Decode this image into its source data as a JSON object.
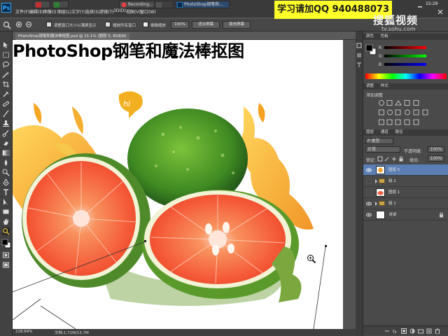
{
  "menubar": {
    "logo": "Ps",
    "items": [
      "文件(F)",
      "编辑(E)",
      "图像(I)",
      "图层(L)",
      "文字(Y)",
      "选择(S)",
      "滤镜(T)",
      "3D(D)",
      "视图(V)",
      "窗口(W)"
    ],
    "taskbar_tabs": [
      {
        "label": ""
      },
      {
        "label": ""
      },
      {
        "label": "Recording..."
      },
      {
        "label": ""
      },
      {
        "label": "PhotoShop钢笔和..."
      }
    ],
    "qq_banner": "学习请加QQ 940488073",
    "clock": "15:29"
  },
  "options": {
    "resize_windows": "调整窗口大小以满屏显示",
    "zoom_all": "缩放所有窗口",
    "scrubby_zoom": "细微缩放",
    "zoom_100": "100%",
    "fit_screen": "适合屏幕",
    "fill_screen": "填充屏幕"
  },
  "watermark": {
    "logo": "搜狐视频",
    "url": "tv.sohu.com"
  },
  "document": {
    "tab_label": "PhotoShop钢笔和魔法棒抠图.psd @ 11.1% (图层 5, RGB/8)",
    "canvas_title": "PhotoShop钢笔和魔法棒抠图",
    "speech_bubble": "hi"
  },
  "statusbar": {
    "zoom": "128.84%",
    "doc_size": "文档:1.71M/13.7M"
  },
  "panels": {
    "color_tab": "颜色",
    "swatch_tab": "色板",
    "color_channels": [
      "R",
      "G",
      "B"
    ],
    "channel_values": [
      "",
      "",
      ""
    ],
    "adjust_tab": "调整",
    "style_tab": "样式",
    "adjust_title": "添加调整",
    "layers_tab": "图层",
    "channels_tab": "通道",
    "paths_tab": "路径",
    "kind_filter": "P 类型",
    "blend_mode": "正常",
    "opacity_label": "不透明度:",
    "opacity_value": "100%",
    "lock_label": "锁定:",
    "fill_label": "填充:",
    "fill_value": "100%",
    "layers": [
      {
        "name": "图层 5",
        "type": "layer",
        "selected": true
      },
      {
        "name": "组 2",
        "type": "group",
        "selected": false
      },
      {
        "name": "图层 1",
        "type": "layer",
        "selected": false
      },
      {
        "name": "组 1",
        "type": "group",
        "selected": false
      },
      {
        "name": "背景",
        "type": "background",
        "selected": false
      }
    ]
  },
  "colors": {
    "ui_dark": "#3a3a3a",
    "ui_mid": "#4a4a4a",
    "banner": "#ffff2a",
    "selection": "#5b7fb5",
    "lime_green": "#4f9a2a",
    "orange_flesh": "#f7553a"
  }
}
